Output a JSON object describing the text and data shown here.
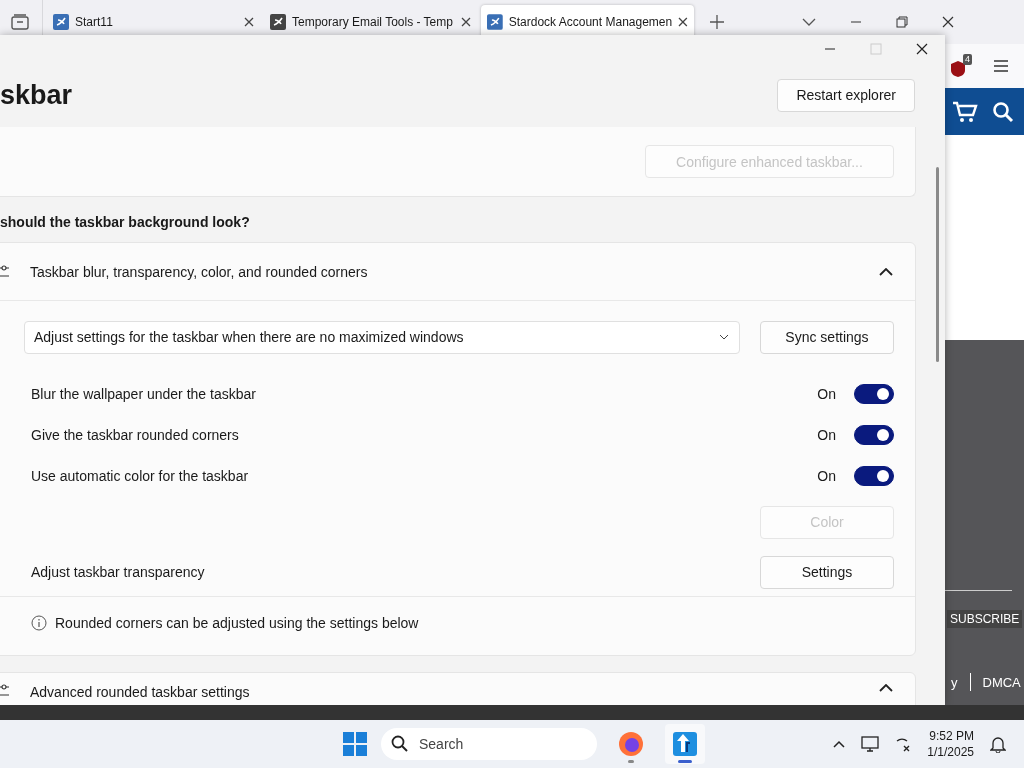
{
  "browser": {
    "tabs": [
      {
        "title": "Start11",
        "selected": false
      },
      {
        "title": "Temporary Email Tools - Temp",
        "selected": false
      },
      {
        "title": "Stardock Account Managemen",
        "selected": true
      }
    ],
    "extension_badge": "4",
    "page": {
      "subscribe": "SUBSCRIBE",
      "footer_links": [
        "y",
        "DMCA"
      ]
    }
  },
  "app": {
    "heading": "skbar",
    "restart_button": "Restart explorer",
    "configure_button": {
      "label": "Configure enhanced taskbar...",
      "disabled": true
    },
    "section_title": "should the taskbar background look?",
    "expander": {
      "title": "Taskbar blur, transparency, color, and rounded corners",
      "expanded": true
    },
    "dropdown": {
      "value": "Adjust settings for the taskbar when there are no maximized windows"
    },
    "sync_button": "Sync settings",
    "toggles": [
      {
        "label": "Blur the wallpaper under the taskbar",
        "state_text": "On",
        "on": true
      },
      {
        "label": "Give the taskbar rounded corners",
        "state_text": "On",
        "on": true
      },
      {
        "label": "Use automatic color for the taskbar",
        "state_text": "On",
        "on": true
      }
    ],
    "color_button": {
      "label": "Color",
      "disabled": true
    },
    "transparency": {
      "label": "Adjust taskbar transparency",
      "button": "Settings"
    },
    "info": "Rounded corners can be adjusted using the settings below",
    "expander2": {
      "title": "Advanced rounded taskbar settings",
      "expanded": true
    }
  },
  "taskbar": {
    "search_placeholder": "Search",
    "apps": [
      {
        "kind": "firefox",
        "active": false
      },
      {
        "kind": "start11",
        "active": true
      }
    ],
    "time": "9:52 PM",
    "date": "1/1/2025"
  }
}
